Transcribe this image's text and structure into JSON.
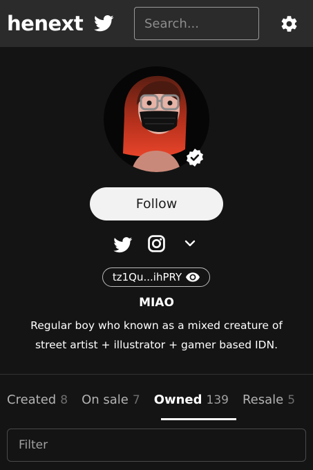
{
  "header": {
    "logo": "henext",
    "search_placeholder": "Search...",
    "icons": {
      "twitter": "twitter-icon",
      "settings": "gear-icon"
    }
  },
  "profile": {
    "follow_label": "Follow",
    "address": "tz1Qu...ihPRY",
    "name": "MIAO",
    "bio": "Regular boy who known as a mixed creature of street artist + illustrator + gamer based IDN.",
    "social_icons": [
      "twitter-icon",
      "instagram-icon",
      "chevron-down-icon"
    ]
  },
  "tabs": [
    {
      "label": "Created",
      "count": "8"
    },
    {
      "label": "On sale",
      "count": "7"
    },
    {
      "label": "Owned",
      "count": "139",
      "active": true
    },
    {
      "label": "Resale",
      "count": "5"
    }
  ],
  "filter": {
    "placeholder": "Filter"
  },
  "colors": {
    "background": "#141414",
    "header": "#2b2b2b",
    "button": "#f2f2f2"
  }
}
